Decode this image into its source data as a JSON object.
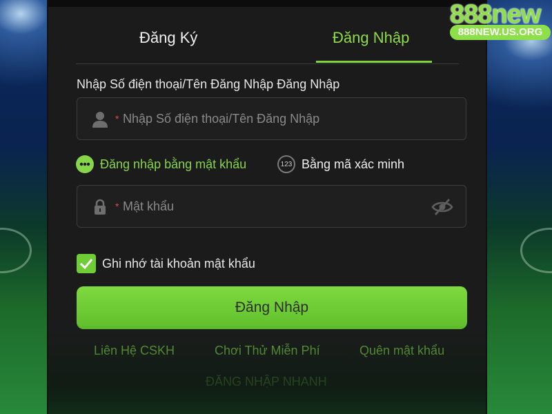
{
  "tabs": {
    "register": "Đăng Ký",
    "login": "Đăng Nhập"
  },
  "form": {
    "label": "Nhập Số điện thoại/Tên Đăng Nhập Đăng Nhập",
    "username_placeholder": "Nhập Số điện thoại/Tên Đăng Nhập",
    "required_mark": "*",
    "password_placeholder": "Mật khẩu",
    "mode_password": "Đăng nhập bằng mật khẩu",
    "mode_code": "Bằng mã xác minh",
    "mode_code_badge": "123",
    "remember": "Ghi nhớ tài khoản mật khẩu",
    "submit": "Đăng Nhập"
  },
  "links": {
    "support": "Liên Hệ CSKH",
    "trial": "Chơi Thử Miễn Phí",
    "forgot": "Quên mật khẩu"
  },
  "quick_login": "ĐĂNG NHẬP NHANH",
  "brand": {
    "name": "888new",
    "url": "888NEW.US.ORG"
  },
  "colors": {
    "accent": "#7fd63c",
    "panel": "#1b1b1c",
    "error": "#e34b4b"
  },
  "icons": {
    "user": "user-icon",
    "lock": "lock-icon",
    "eye": "eye-off-icon",
    "check": "check-icon"
  }
}
